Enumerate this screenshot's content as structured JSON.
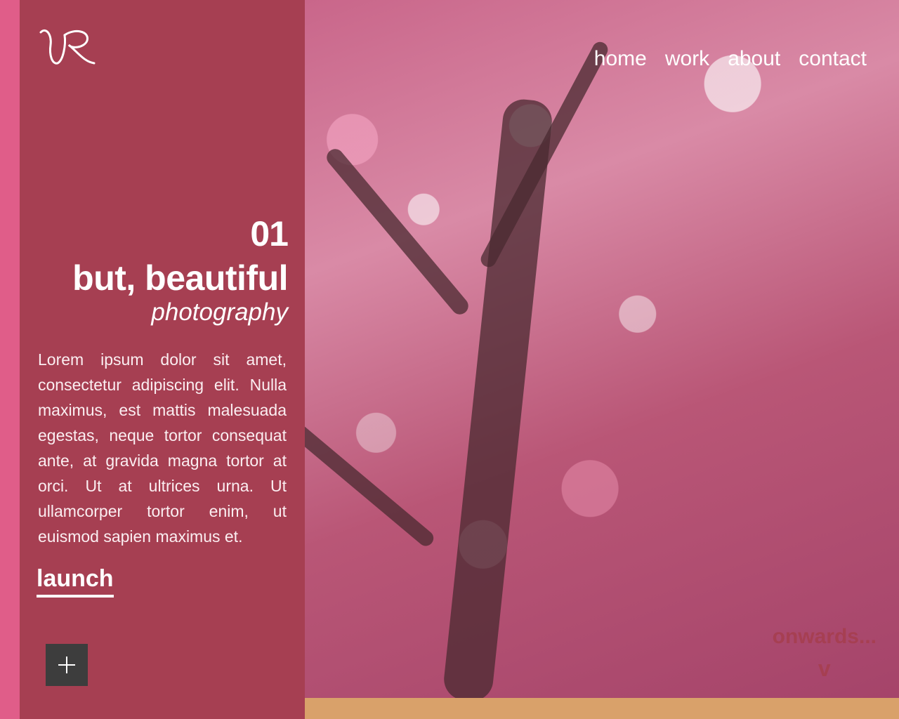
{
  "logo": {
    "text": "VR"
  },
  "nav": {
    "items": [
      "home",
      "work",
      "about",
      "contact"
    ]
  },
  "feature": {
    "number": "01",
    "title": "but, beautiful",
    "subtitle": "photography",
    "body": "Lorem ipsum dolor sit amet, consectetur adipiscing elit. Nulla maximus, est mattis malesuada egestas, neque tortor consequat ante, at gravida magna tortor at orci. Ut at ultrices urna. Ut ullamcorper tortor enim, ut euismod sapien maximus et.",
    "launch_label": "launch"
  },
  "scroll_hint": {
    "label": "onwards...",
    "chevron": "v"
  },
  "colors": {
    "accent_strip": "#e05d89",
    "panel": "#a63f52",
    "footer": "#d9a16a",
    "button": "#3d3d3d"
  },
  "icons": {
    "expand": "plus-icon",
    "logo": "vr-signature-logo"
  }
}
